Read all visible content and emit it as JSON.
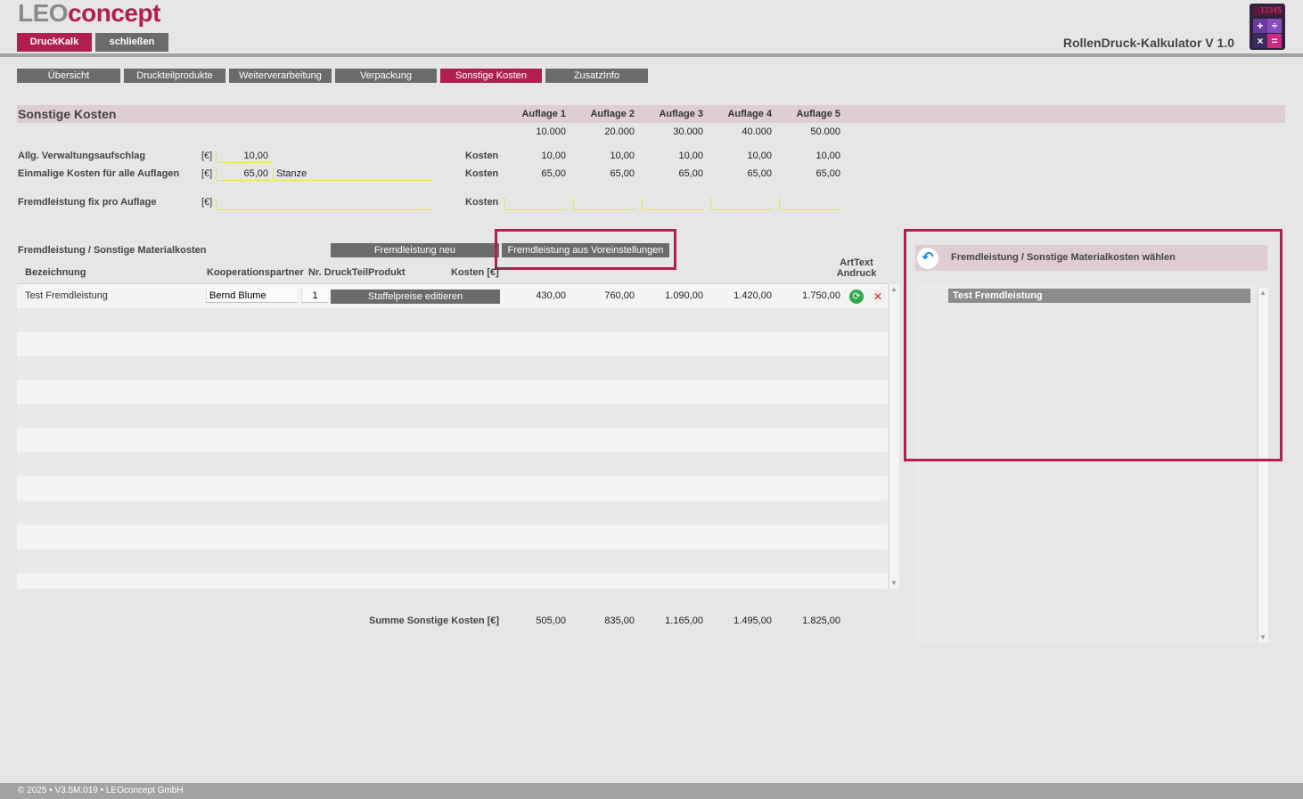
{
  "header": {
    "logo_part1": "LEO",
    "logo_part2": "concept",
    "btn_druckkalk": "DruckKalk",
    "btn_schliessen": "schließen",
    "app_title": "RollenDruck-Kalkulator V 1.0",
    "calc_screen": "12345",
    "calc_keys": [
      "+",
      "÷",
      "×",
      "="
    ]
  },
  "tabs": [
    {
      "label": "Übersicht",
      "active": false
    },
    {
      "label": "Druckteilprodukte",
      "active": false
    },
    {
      "label": "Weiterverarbeitung",
      "active": false
    },
    {
      "label": "Verpackung",
      "active": false
    },
    {
      "label": "Sonstige Kosten",
      "active": true
    },
    {
      "label": "ZusatzInfo",
      "active": false
    }
  ],
  "section": {
    "title": "Sonstige Kosten",
    "auflagen_headers": [
      "Auflage 1",
      "Auflage 2",
      "Auflage 3",
      "Auflage 4",
      "Auflage 5"
    ],
    "auflagen_values": [
      "10.000",
      "20.000",
      "30.000",
      "40.000",
      "50.000"
    ]
  },
  "verwaltung": {
    "label": "Allg. Verwaltungsaufschlag",
    "unit": "[€]",
    "value": "10,00",
    "kosten_label": "Kosten",
    "costs": [
      "10,00",
      "10,00",
      "10,00",
      "10,00",
      "10,00"
    ]
  },
  "einmalig": {
    "label": "Einmalige Kosten für alle Auflagen",
    "unit": "[€]",
    "value": "65,00",
    "note": "Stanze",
    "kosten_label": "Kosten",
    "costs": [
      "65,00",
      "65,00",
      "65,00",
      "65,00",
      "65,00"
    ]
  },
  "fremd_fix": {
    "label": "Fremdleistung fix pro Auflage",
    "unit": "[€]",
    "kosten_label": "Kosten"
  },
  "table": {
    "title": "Fremdleistung /  Sonstige Materialkosten",
    "btn_neu": "Fremdleistung neu",
    "btn_voreinstellungen": "Fremdleistung aus Voreinstellungen",
    "col_bezeichnung": "Bezeichnung",
    "col_partner": "Kooperationspartner",
    "col_nr": "Nr. DruckTeilProdukt",
    "col_kosten": "Kosten [€]",
    "col_arttext_1": "ArtText",
    "col_arttext_2": "Andruck",
    "rows": [
      {
        "bezeichnung": "Test Fremdleistung",
        "partner": "Bernd Blume",
        "nr": "1",
        "btn_staffel": "Staffelpreise editieren",
        "values": [
          "430,00",
          "760,00",
          "1.090,00",
          "1.420,00",
          "1.750,00"
        ]
      }
    ]
  },
  "summe": {
    "label": "Summe Sonstige Kosten [€]",
    "values": [
      "505,00",
      "835,00",
      "1.165,00",
      "1.495,00",
      "1.825,00"
    ]
  },
  "picker": {
    "title": "Fremdleistung /  Sonstige Materialkosten wählen",
    "items": [
      "Test Fremdleistung"
    ]
  },
  "footer": {
    "text": "© 2025 • V3.5M.019 • LEOconcept GmbH"
  },
  "colors": {
    "accent": "#b0204e",
    "button_gray": "#6b6b6b",
    "section_bar": "#dfcdd3"
  }
}
